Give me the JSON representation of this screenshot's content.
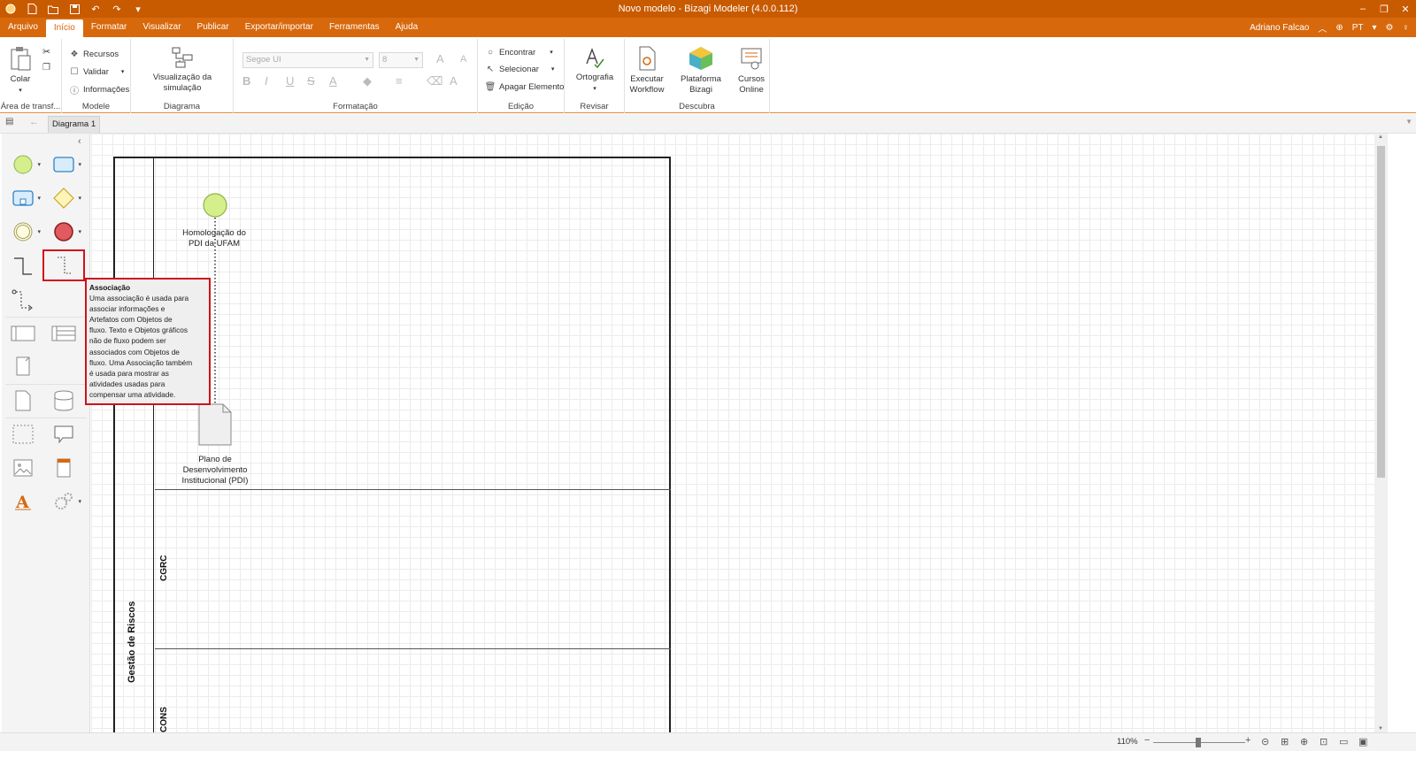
{
  "app": {
    "window_title": "Novo modelo - Bizagi Modeler (4.0.0.112)"
  },
  "menu": {
    "tabs": [
      "Arquivo",
      "Início",
      "Formatar",
      "Visualizar",
      "Publicar",
      "Exportar/importar",
      "Ferramentas",
      "Ajuda"
    ],
    "active_tab": "Início",
    "user": "Adriano Falcao",
    "language": "PT"
  },
  "ribbon": {
    "clipboard": {
      "paste": "Colar",
      "title": "Área de transf..."
    },
    "model": {
      "resources": "Recursos",
      "validate": "Validar",
      "info": "Informações",
      "title": "Modele"
    },
    "diagram": {
      "simulation": "Visualização da simulação",
      "title": "Diagrama"
    },
    "format": {
      "font_name": "Segoe UI",
      "font_size": "8",
      "title": "Formatação"
    },
    "edit": {
      "find": "Encontrar",
      "select": "Selecionar",
      "delete": "Apagar Elemento",
      "title": "Edição"
    },
    "review": {
      "spelling": "Ortografia",
      "title": "Revisar"
    },
    "discover": {
      "workflow_line1": "Executar",
      "workflow_line2": "Workflow",
      "platform": "Plataforma Bizagi",
      "courses_line1": "Cursos",
      "courses_line2": "Online",
      "title": "Descubra"
    }
  },
  "document_tab": "Diagrama 1",
  "diagram": {
    "pool_name": "Gestão de Riscos",
    "lanes": [
      "CGRC",
      "CONS"
    ],
    "start_event_label_line1": "Homologação do",
    "start_event_label_line2": "PDI da UFAM",
    "artifact_label_line1": "Plano de",
    "artifact_label_line2": "Desenvolvimento",
    "artifact_label_line3": "Institucional (PDI)"
  },
  "tooltip": {
    "title": "Associação",
    "lines": [
      "Uma associação é usada para",
      "associar informações e",
      "Artefatos com Objetos de",
      "fluxo. Texto e Objetos gráficos",
      "não de fluxo podem ser",
      "associados com Objetos de",
      "fluxo. Uma Associação também",
      "é usada para mostrar as",
      "atividades usadas para",
      "compensar uma atividade."
    ]
  },
  "status": {
    "zoom": "110%"
  },
  "colors": {
    "titlebar": "#c85a00",
    "menubar": "#d7680c",
    "highlight": "#d0121b",
    "start_event": "#d4ef8c",
    "end_event": "#e05a5f"
  }
}
